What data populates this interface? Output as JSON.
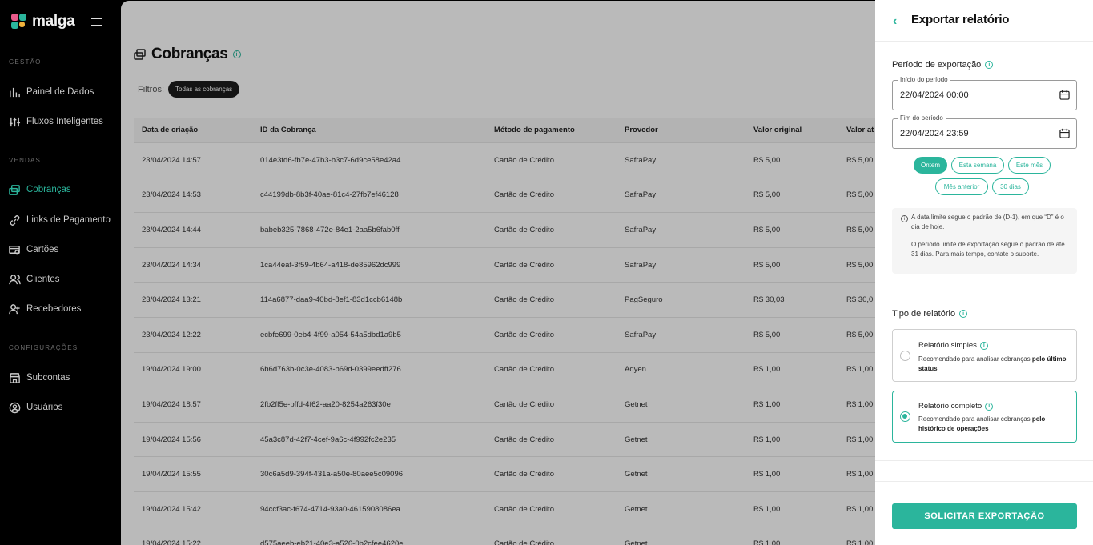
{
  "sidebar": {
    "logo_text": "malga",
    "sections": {
      "gestao": "GESTÃO",
      "vendas": "VENDAS",
      "config": "CONFIGURAÇÕES"
    },
    "items": {
      "painel": "Painel de Dados",
      "fluxos": "Fluxos Inteligentes",
      "cobrancas": "Cobranças",
      "links": "Links de Pagamento",
      "cartoes": "Cartões",
      "clientes": "Clientes",
      "recebedores": "Recebedores",
      "subcontas": "Subcontas",
      "usuarios": "Usuários"
    }
  },
  "main": {
    "title": "Cobranças",
    "filters_label": "Filtros:",
    "filter_chip": "Todas as cobranças",
    "columns": [
      "Data de criação",
      "ID da Cobrança",
      "Método de pagamento",
      "Provedor",
      "Valor original",
      "Valor at"
    ],
    "rows": [
      [
        "23/04/2024 14:57",
        "014e3fd6-fb7e-47b3-b3c7-6d9ce58e42a4",
        "Cartão de Crédito",
        "SafraPay",
        "R$ 5,00",
        "R$ 5,00"
      ],
      [
        "23/04/2024 14:53",
        "c44199db-8b3f-40ae-81c4-27fb7ef46128",
        "Cartão de Crédito",
        "SafraPay",
        "R$ 5,00",
        "R$ 5,00"
      ],
      [
        "23/04/2024 14:44",
        "babeb325-7868-472e-84e1-2aa5b6fab0ff",
        "Cartão de Crédito",
        "SafraPay",
        "R$ 5,00",
        "R$ 5,00"
      ],
      [
        "23/04/2024 14:34",
        "1ca44eaf-3f59-4b64-a418-de85962dc999",
        "Cartão de Crédito",
        "SafraPay",
        "R$ 5,00",
        "R$ 5,00"
      ],
      [
        "23/04/2024 13:21",
        "114a6877-daa9-40bd-8ef1-83d1ccb6148b",
        "Cartão de Crédito",
        "PagSeguro",
        "R$ 30,03",
        "R$ 30,0"
      ],
      [
        "23/04/2024 12:22",
        "ecbfe699-0eb4-4f99-a054-54a5dbd1a9b5",
        "Cartão de Crédito",
        "SafraPay",
        "R$ 5,00",
        "R$ 5,00"
      ],
      [
        "19/04/2024 19:00",
        "6b6d763b-0c3e-4083-b69d-0399eedff276",
        "Cartão de Crédito",
        "Adyen",
        "R$ 1,00",
        "R$ 1,00"
      ],
      [
        "19/04/2024 18:57",
        "2fb2ff5e-bffd-4f62-aa20-8254a263f30e",
        "Cartão de Crédito",
        "Getnet",
        "R$ 1,00",
        "R$ 1,00"
      ],
      [
        "19/04/2024 15:56",
        "45a3c87d-42f7-4cef-9a6c-4f992fc2e235",
        "Cartão de Crédito",
        "Getnet",
        "R$ 1,00",
        "R$ 1,00"
      ],
      [
        "19/04/2024 15:55",
        "30c6a5d9-394f-431a-a50e-80aee5c09096",
        "Cartão de Crédito",
        "Getnet",
        "R$ 1,00",
        "R$ 1,00"
      ],
      [
        "19/04/2024 15:42",
        "94ccf3ac-f674-4714-93a0-4615908086ea",
        "Cartão de Crédito",
        "Getnet",
        "R$ 1,00",
        "R$ 1,00"
      ],
      [
        "19/04/2024 15:22",
        "d575aeeb-eb21-40e3-a526-0b2cfee4620e",
        "Cartão de Crédito",
        "Getnet",
        "R$ 1,00",
        "R$ 1,00"
      ]
    ]
  },
  "panel": {
    "title": "Exportar relatório",
    "period_title": "Período de exportação",
    "start_label": "Início do período",
    "start_value": "22/04/2024 00:00",
    "end_label": "Fim do período",
    "end_value": "22/04/2024 23:59",
    "quick": {
      "ontem": "Ontem",
      "semana": "Esta semana",
      "mes": "Este mês",
      "anterior": "Mês anterior",
      "trinta": "30 dias"
    },
    "note1": "A data limite segue o padrão de (D-1), em que “D” é o dia de hoje.",
    "note2": "O período limite de exportação segue o padrão de até 31 dias. Para mais tempo, contate o suporte.",
    "type_title": "Tipo de relatório",
    "simple_title": "Relatório simples",
    "simple_desc": "Recomendado para analisar cobranças ",
    "simple_bold": "pelo último status",
    "complete_title": "Relatório completo",
    "complete_desc": "Recomendado para analisar cobranças ",
    "complete_bold": "pelo histórico de operações",
    "submit": "SOLICITAR EXPORTAÇÃO"
  },
  "colors": {
    "accent": "#2bb59c",
    "sidebar_bg": "#000000"
  }
}
